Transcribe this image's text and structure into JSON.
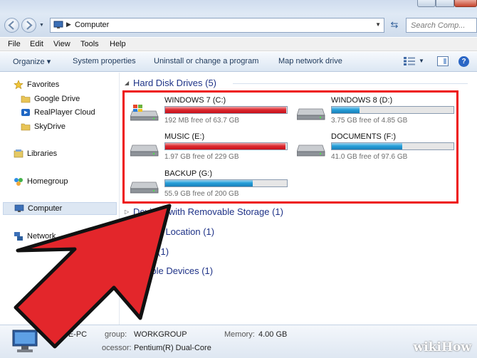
{
  "address": {
    "location": "Computer",
    "search_placeholder": "Search Comp..."
  },
  "menu": [
    "File",
    "Edit",
    "View",
    "Tools",
    "Help"
  ],
  "commands": {
    "organize": "Organize ▾",
    "system_properties": "System properties",
    "uninstall": "Uninstall or change a program",
    "map_drive": "Map network drive"
  },
  "sidebar": {
    "favorites": "Favorites",
    "google_drive": "Google Drive",
    "realplayer": "RealPlayer Cloud",
    "skydrive": "SkyDrive",
    "libraries": "Libraries",
    "homegroup": "Homegroup",
    "computer": "Computer",
    "network": "Network"
  },
  "groups": {
    "hdd": "Hard Disk Drives (5)",
    "removable": "Devices with Removable Storage (1)",
    "netloc": "rk Location (1)",
    "other": "er (1)",
    "portable": "ortable Devices (1)"
  },
  "drives": [
    {
      "name": "WINDOWS 7 (C:)",
      "free": "192 MB free of 63.7 GB",
      "used_fraction": 0.997,
      "state": "red",
      "icon": "windows-drive-icon"
    },
    {
      "name": "WINDOWS 8 (D:)",
      "free": "3.75 GB free of 4.85 GB",
      "used_fraction": 0.23,
      "state": "blue",
      "icon": "hard-drive-icon"
    },
    {
      "name": "MUSIC (E:)",
      "free": "1.97 GB free of 229 GB",
      "used_fraction": 0.991,
      "state": "red",
      "icon": "hard-drive-icon"
    },
    {
      "name": "DOCUMENTS (F:)",
      "free": "41.0 GB free of 97.6 GB",
      "used_fraction": 0.58,
      "state": "blue",
      "icon": "hard-drive-icon"
    },
    {
      "name": "BACKUP (G:)",
      "free": "55.9 GB free of 200 GB",
      "used_fraction": 0.72,
      "state": "blue",
      "icon": "hard-drive-icon"
    }
  ],
  "details": {
    "pc_name": "RAGE-PC",
    "workgroup_label": "group:",
    "workgroup": "WORKGROUP",
    "memory_label": "Memory:",
    "memory": "4.00 GB",
    "processor_label": "ocessor:",
    "processor": "Pentium(R) Dual-Core"
  },
  "watermark": "wikiHow",
  "colors": {
    "highlight_box": "#ee1111",
    "arrow": "#e3262b",
    "bar_full": "#dc2b31",
    "bar_normal": "#26a0da"
  }
}
